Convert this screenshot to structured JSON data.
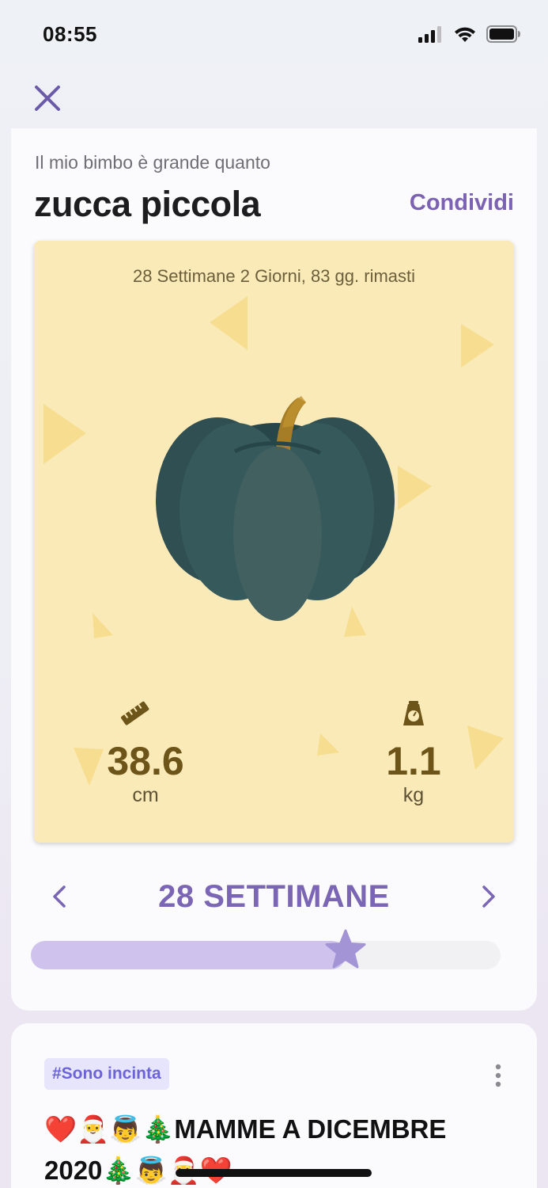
{
  "status_bar": {
    "time": "08:55"
  },
  "header": {
    "subtitle": "Il mio bimbo è grande quanto",
    "title": "zucca piccola",
    "share_label": "Condividi"
  },
  "fruit_card": {
    "weeks_info": "28 Settimane 2 Giorni, 83 gg. rimasti",
    "length": {
      "value": "38.6",
      "unit": "cm",
      "icon": "ruler-icon"
    },
    "weight": {
      "value": "1.1",
      "unit": "kg",
      "icon": "scale-icon"
    },
    "illustration": "pumpkin-illustration",
    "background_color": "#faeab8"
  },
  "week_nav": {
    "label": "28 SETTIMANE",
    "prev_icon": "chevron-left-icon",
    "next_icon": "chevron-right-icon"
  },
  "progress": {
    "fraction": 0.67,
    "marker_icon": "star-icon",
    "accent_color": "#a394d6"
  },
  "post": {
    "tag": "#Sono incinta",
    "title_line1": "❤️🎅👼🎄MAMME A DICEMBRE",
    "title_line2": "2020🎄👼🎅❤️"
  },
  "colors": {
    "accent": "#7b62b3",
    "tag_text": "#6b63d7"
  }
}
